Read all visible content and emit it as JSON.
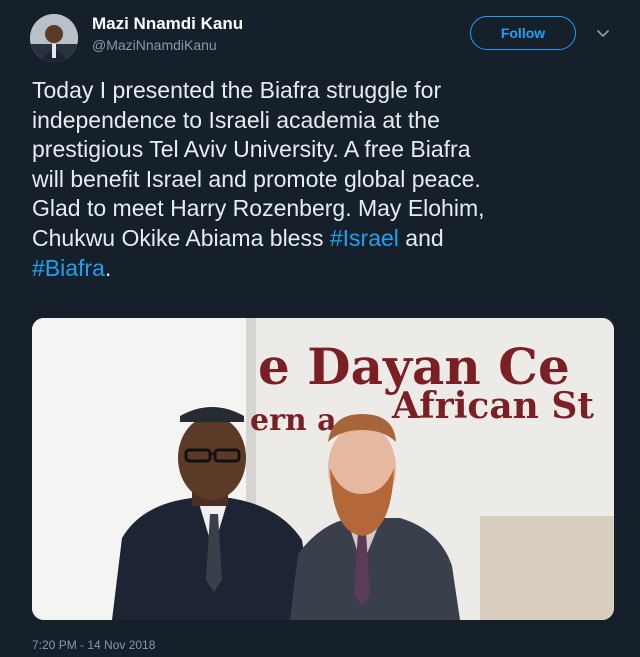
{
  "author": {
    "display_name": "Mazi Nnamdi Kanu",
    "handle": "@MaziNnamdiKanu"
  },
  "follow_button": {
    "label": "Follow"
  },
  "tweet": {
    "lines": [
      "Today I presented the Biafra struggle for",
      "independence to Israeli academia at the",
      "prestigious Tel Aviv University. A free Biafra",
      "will benefit Israel and promote global peace.",
      "Glad to meet Harry Rozenberg. May Elohim,"
    ],
    "line6_prefix": "Chukwu Okike Abiama bless ",
    "hashtag_israel": "#Israel",
    "line6_middle": " and",
    "hashtag_biafra": "#Biafra",
    "line7_suffix": "."
  },
  "photo": {
    "sign_line1": "e Dayan Ce",
    "sign_line2_left": "ern a",
    "sign_line2_right": "African St"
  },
  "timestamp": "7:20 PM - 14 Nov 2018",
  "colors": {
    "background": "#15202b",
    "text": "#e6ecf0",
    "secondary_text": "#8899a6",
    "accent": "#1da1f2",
    "sign_text": "#7a1f24"
  },
  "icons": {
    "chevron": "chevron-down-icon"
  }
}
